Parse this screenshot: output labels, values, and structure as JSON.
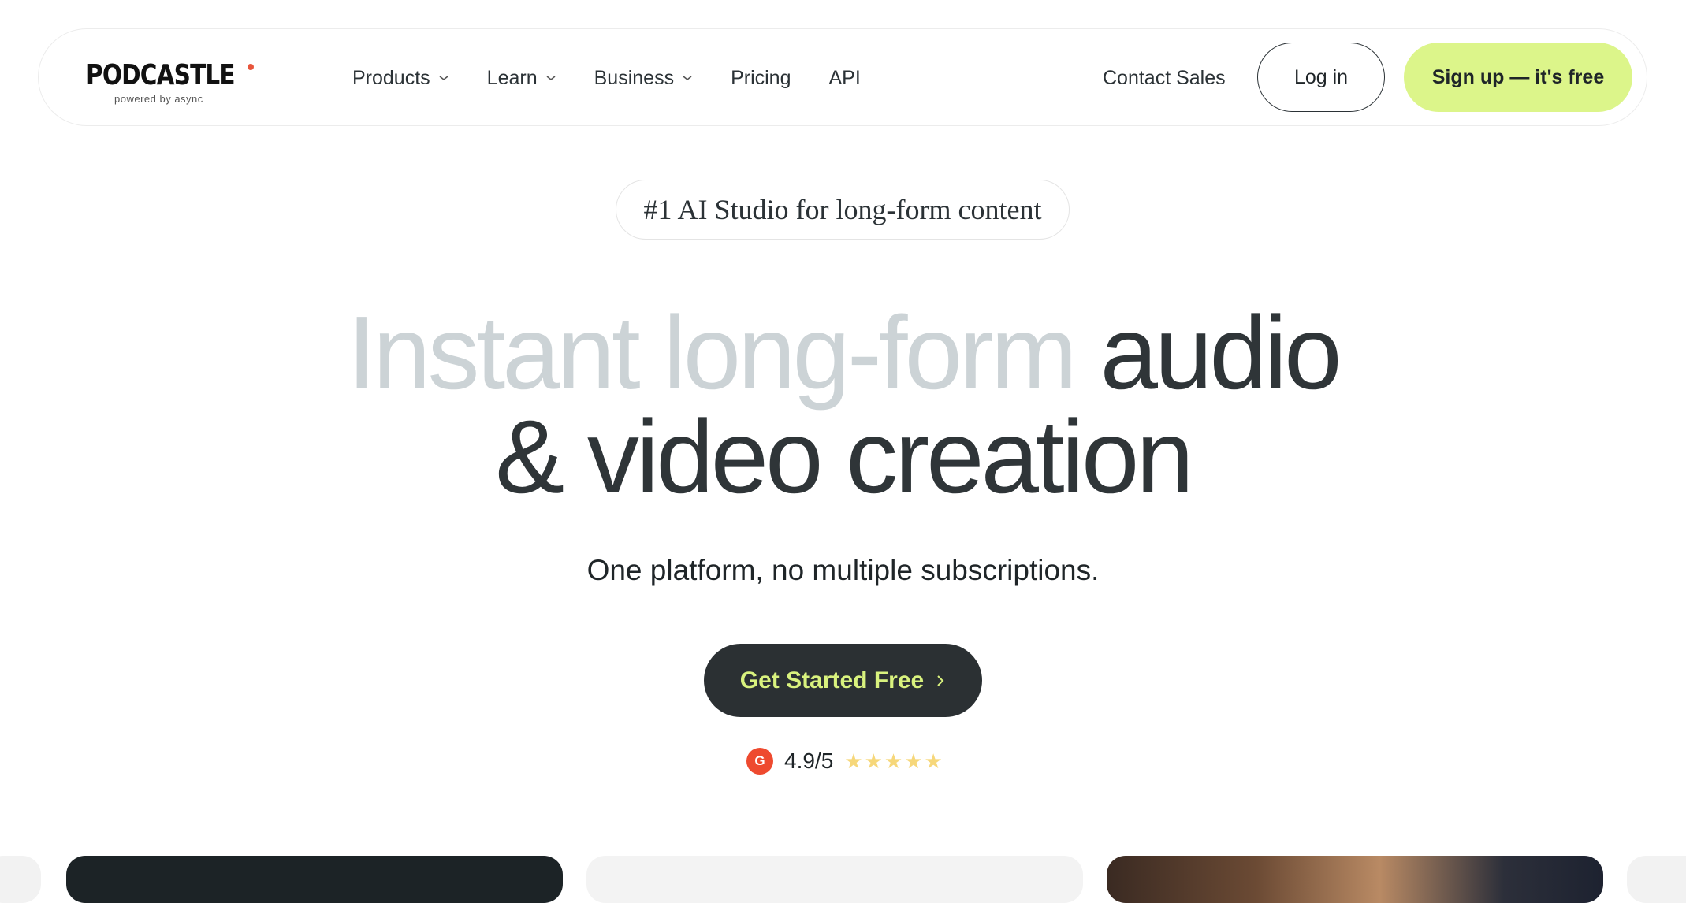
{
  "nav": {
    "logo_text": "PODCASTLE",
    "logo_sub": "powered by async",
    "menu": [
      {
        "label": "Products",
        "has_dropdown": true
      },
      {
        "label": "Learn",
        "has_dropdown": true
      },
      {
        "label": "Business",
        "has_dropdown": true
      },
      {
        "label": "Pricing",
        "has_dropdown": false
      },
      {
        "label": "API",
        "has_dropdown": false
      }
    ],
    "contact_label": "Contact Sales",
    "login_label": "Log in",
    "signup_label": "Sign up — it's free"
  },
  "hero": {
    "badge": "#1 AI Studio for long-form content",
    "headline_muted": "Instant long-form",
    "headline_dark_1": "audio",
    "headline_dark_2": "& video creation",
    "subhead": "One platform, no multiple subscriptions.",
    "cta_label": "Get Started Free",
    "rating_source": "G",
    "rating_score": "4.9/5",
    "stars": 5
  },
  "colors": {
    "accent": "#dcf58a",
    "dark": "#2b3033",
    "muted_text": "#ccd3d6",
    "g2": "#ee4a2f",
    "star": "#f6d77a"
  },
  "icons": [
    "chevron-down-icon",
    "chevron-right-icon",
    "g2-logo-icon",
    "star-icon"
  ]
}
